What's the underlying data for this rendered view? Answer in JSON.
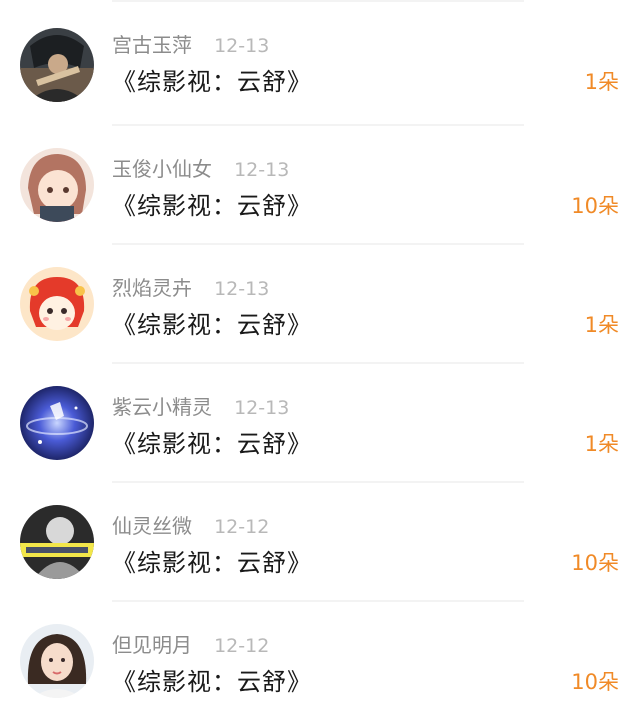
{
  "items": [
    {
      "name": "宫古玉萍",
      "date": "12-13",
      "title": "《综影视：云舒》",
      "amount": "1朵"
    },
    {
      "name": "玉俊小仙女",
      "date": "12-13",
      "title": "《综影视：云舒》",
      "amount": "10朵"
    },
    {
      "name": "烈焰灵卉",
      "date": "12-13",
      "title": "《综影视：云舒》",
      "amount": "1朵"
    },
    {
      "name": "紫云小精灵",
      "date": "12-13",
      "title": "《综影视：云舒》",
      "amount": "1朵"
    },
    {
      "name": "仙灵丝微",
      "date": "12-12",
      "title": "《综影视：云舒》",
      "amount": "10朵"
    },
    {
      "name": "但见明月",
      "date": "12-12",
      "title": "《综影视：云舒》",
      "amount": "10朵"
    }
  ],
  "colors": {
    "name": "#8c8c8c",
    "date": "#b8b8b8",
    "title": "#1a1a1a",
    "amount": "#f08a27"
  }
}
